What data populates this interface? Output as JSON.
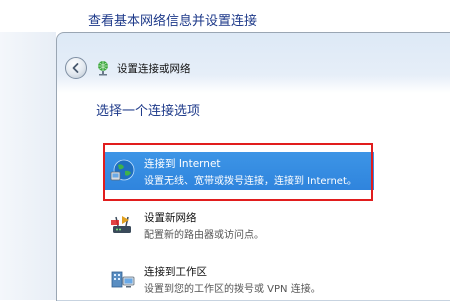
{
  "background_window": {
    "title": "查看基本网络信息并设置连接"
  },
  "dialog": {
    "nav_title": "设置连接或网络",
    "heading": "选择一个连接选项",
    "options": [
      {
        "title": "连接到 Internet",
        "description": "设置无线、宽带或拨号连接，连接到 Internet。",
        "icon": "globe-network-icon",
        "selected": true
      },
      {
        "title": "设置新网络",
        "description": "配置新的路由器或访问点。",
        "icon": "router-setup-icon",
        "selected": false
      },
      {
        "title": "连接到工作区",
        "description": "设置到您的工作区的拨号或 VPN 连接。",
        "icon": "workplace-connection-icon",
        "selected": false
      }
    ]
  },
  "colors": {
    "selection": "#3188dd",
    "annotation_border": "#e11d1d",
    "heading_text": "#1e3a8a"
  }
}
